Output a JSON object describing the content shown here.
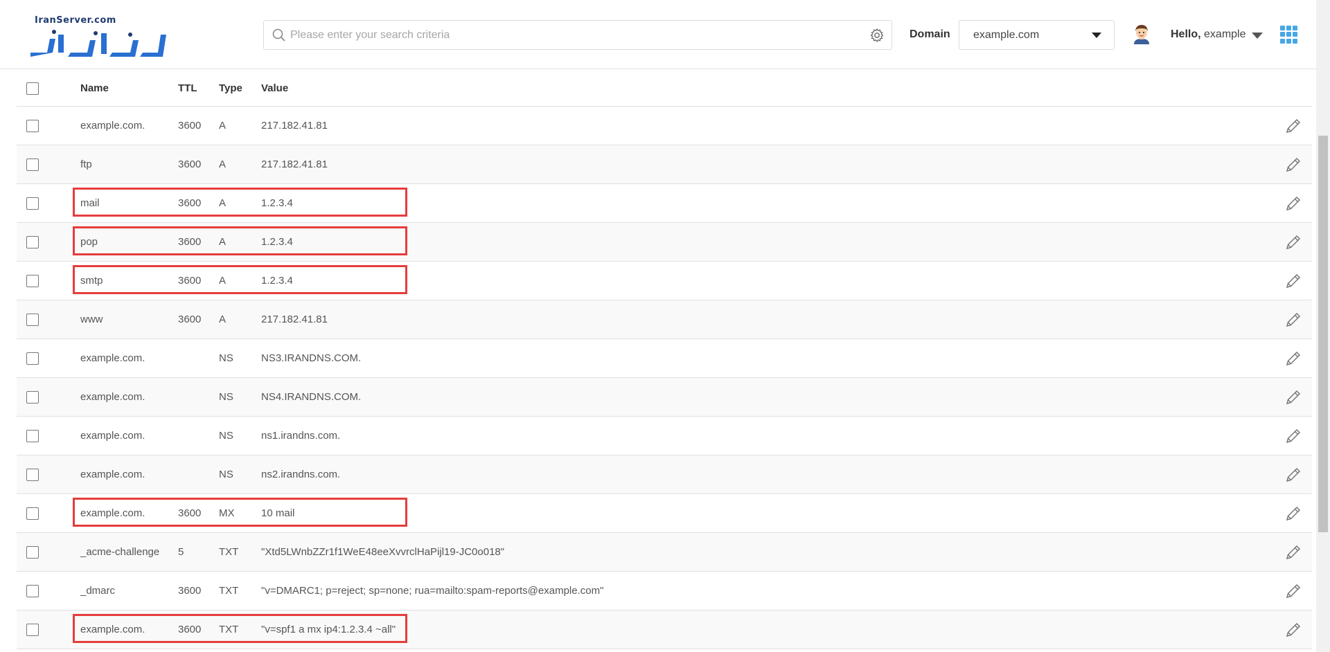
{
  "brand": {
    "logo_text": "IranServer.com",
    "logo_wordmark": "ایران سرور",
    "colors": {
      "logo_blue": "#2a6fd1",
      "logo_dark": "#1f3b70",
      "apps_icon": "#47a7e5",
      "highlight": "#e63c3c"
    }
  },
  "header": {
    "search_placeholder": "Please enter your search criteria",
    "domain_label": "Domain",
    "domain_value": "example.com",
    "hello_prefix": "Hello,",
    "hello_user": "example"
  },
  "icons": {
    "search": "search-icon",
    "settings": "gear-icon",
    "dropdown": "chevron-down-icon",
    "avatar": "user-avatar-icon",
    "apps": "apps-grid-icon",
    "edit": "pencil-icon"
  },
  "table": {
    "columns": [
      "Name",
      "TTL",
      "Type",
      "Value"
    ],
    "rows": [
      {
        "name": "example.com.",
        "ttl": "3600",
        "type": "A",
        "value": "217.182.41.81",
        "highlighted": false
      },
      {
        "name": "ftp",
        "ttl": "3600",
        "type": "A",
        "value": "217.182.41.81",
        "highlighted": false
      },
      {
        "name": "mail",
        "ttl": "3600",
        "type": "A",
        "value": "1.2.3.4",
        "highlighted": true
      },
      {
        "name": "pop",
        "ttl": "3600",
        "type": "A",
        "value": "1.2.3.4",
        "highlighted": true
      },
      {
        "name": "smtp",
        "ttl": "3600",
        "type": "A",
        "value": "1.2.3.4",
        "highlighted": true
      },
      {
        "name": "www",
        "ttl": "3600",
        "type": "A",
        "value": "217.182.41.81",
        "highlighted": false
      },
      {
        "name": "example.com.",
        "ttl": "",
        "type": "NS",
        "value": "NS3.IRANDNS.COM.",
        "highlighted": false
      },
      {
        "name": "example.com.",
        "ttl": "",
        "type": "NS",
        "value": "NS4.IRANDNS.COM.",
        "highlighted": false
      },
      {
        "name": "example.com.",
        "ttl": "",
        "type": "NS",
        "value": "ns1.irandns.com.",
        "highlighted": false
      },
      {
        "name": "example.com.",
        "ttl": "",
        "type": "NS",
        "value": "ns2.irandns.com.",
        "highlighted": false
      },
      {
        "name": "example.com.",
        "ttl": "3600",
        "type": "MX",
        "value": "10 mail",
        "highlighted": true
      },
      {
        "name": "_acme-challenge",
        "ttl": "5",
        "type": "TXT",
        "value": "\"Xtd5LWnbZZr1f1WeE48eeXvvrclHaPijl19-JC0o018\"",
        "highlighted": false
      },
      {
        "name": "_dmarc",
        "ttl": "3600",
        "type": "TXT",
        "value": "\"v=DMARC1; p=reject; sp=none; rua=mailto:spam-reports@example.com\"",
        "highlighted": false
      },
      {
        "name": "example.com.",
        "ttl": "3600",
        "type": "TXT",
        "value": "\"v=spf1 a mx ip4:1.2.3.4 ~all\"",
        "highlighted": true
      }
    ]
  }
}
